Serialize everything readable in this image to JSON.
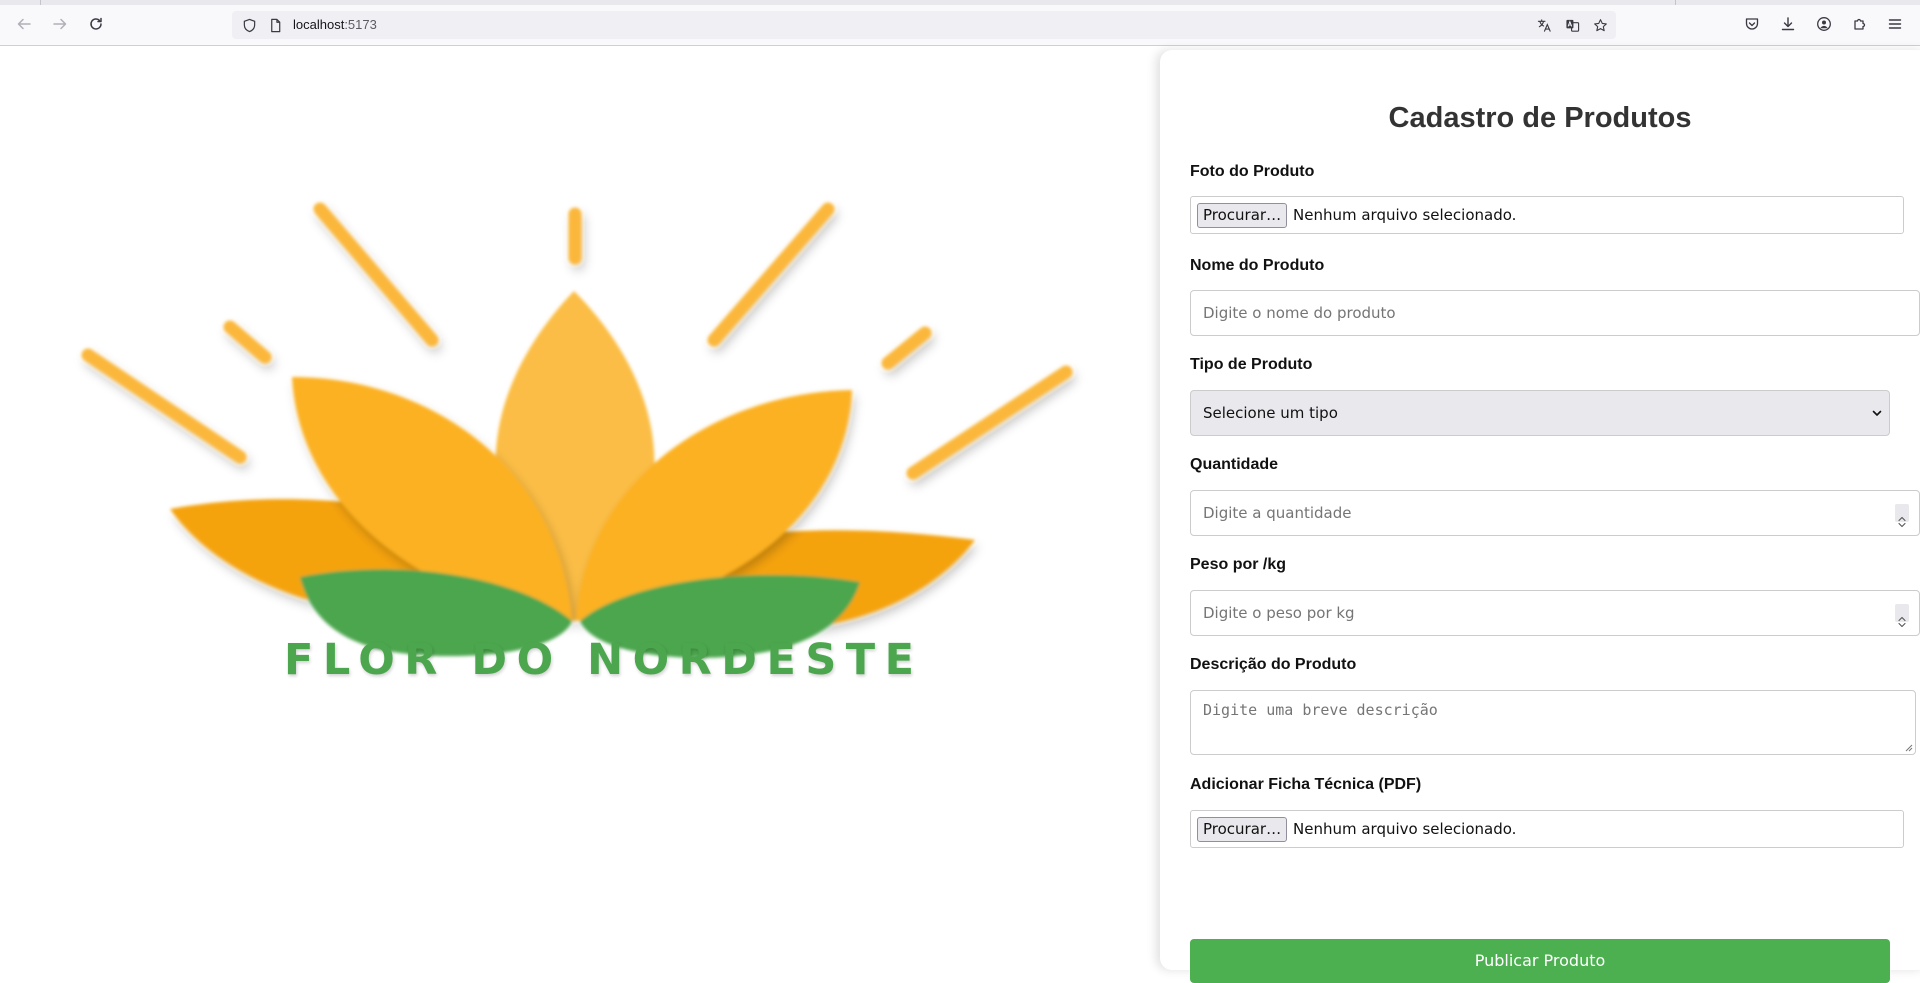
{
  "browser": {
    "url_host": "localhost",
    "url_port": ":5173"
  },
  "logo": {
    "text": "FLOR DO NORDESTE",
    "colors": {
      "ray": "#fbb73a",
      "petal_light": "#fbbd45",
      "petal_mid": "#fcb120",
      "petal_dark": "#f5a30a",
      "leaf": "#4ca64e"
    }
  },
  "form": {
    "title": "Cadastro de Produtos",
    "photo": {
      "label": "Foto do Produto",
      "button": "Procurar…",
      "status": "Nenhum arquivo selecionado."
    },
    "name": {
      "label": "Nome do Produto",
      "placeholder": "Digite o nome do produto"
    },
    "type": {
      "label": "Tipo de Produto",
      "selected": "Selecione um tipo"
    },
    "quantity": {
      "label": "Quantidade",
      "placeholder": "Digite a quantidade"
    },
    "weight": {
      "label": "Peso por /kg",
      "placeholder": "Digite o peso por kg"
    },
    "description": {
      "label": "Descrição do Produto",
      "placeholder": "Digite uma breve descrição"
    },
    "datasheet": {
      "label": "Adicionar Ficha Técnica (PDF)",
      "button": "Procurar…",
      "status": "Nenhum arquivo selecionado."
    },
    "submit": "Publicar Produto",
    "accent_color": "#4caf50"
  }
}
